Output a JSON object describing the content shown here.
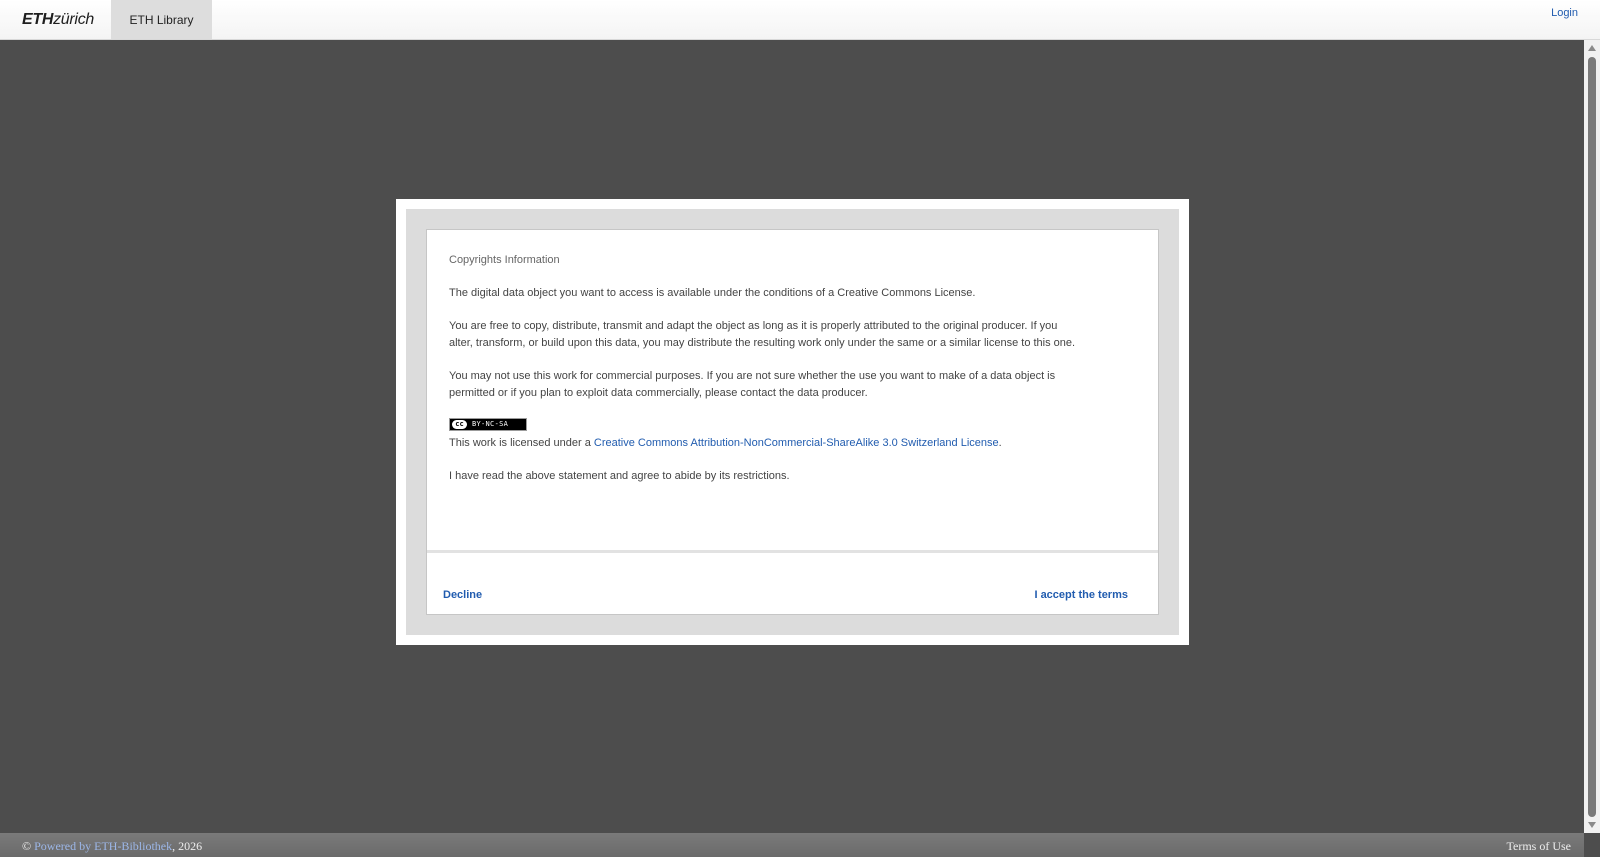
{
  "header": {
    "logo_eth": "ETH",
    "logo_zurich": "zürich",
    "library_tab": "ETH Library",
    "login_label": "Login"
  },
  "modal": {
    "title": "Copyrights Information",
    "paragraphs": [
      "The digital data object you want to access is available under the conditions of a Creative Commons License.",
      "You are free to copy, distribute, transmit and adapt the object as long as it is properly attributed to the original producer. If you alter, transform, or build upon this data, you may distribute the resulting work only under the same or a similar license to this one.",
      "You may not use this work for commercial purposes. If you are not sure whether the use you want to make of a data object is permitted or if you plan to exploit data commercially, please contact the data producer."
    ],
    "cc_badge": {
      "circle": "cc",
      "text": "BY-NC-SA"
    },
    "license_prefix": "This work is licensed under a ",
    "license_link": "Creative Commons Attribution-NonCommercial-ShareAlike 3.0 Switzerland License",
    "license_suffix": ".",
    "agreement": "I have read the above statement and agree to abide by its restrictions.",
    "decline_label": "Decline",
    "accept_label": "I accept the terms"
  },
  "footer": {
    "copyright_symbol": "© ",
    "powered_by": "Powered by ETH-Bibliothek",
    "year": ", 2026",
    "terms_label": "Terms of Use"
  }
}
